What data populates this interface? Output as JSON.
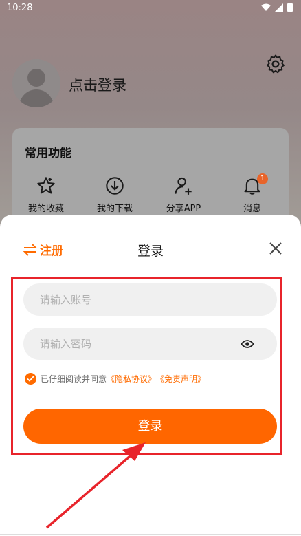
{
  "status_bar": {
    "time": "10:28"
  },
  "profile": {
    "login_prompt": "点击登录"
  },
  "functions": {
    "title": "常用功能",
    "items": [
      {
        "label": "我的收藏",
        "icon": "star-icon"
      },
      {
        "label": "我的下载",
        "icon": "download-icon"
      },
      {
        "label": "分享APP",
        "icon": "add-user-icon"
      },
      {
        "label": "消息",
        "icon": "bell-icon",
        "badge": "1"
      }
    ]
  },
  "sheet": {
    "register_label": "注册",
    "title": "登录",
    "account_placeholder": "请输入账号",
    "password_placeholder": "请输入密码",
    "agree_text": "已仔细阅读并同意",
    "privacy_link": "《隐私协议》",
    "disclaimer_link": "《免责声明》",
    "login_label": "登录"
  },
  "colors": {
    "accent": "#ff6600",
    "annotation": "#e8242b"
  }
}
